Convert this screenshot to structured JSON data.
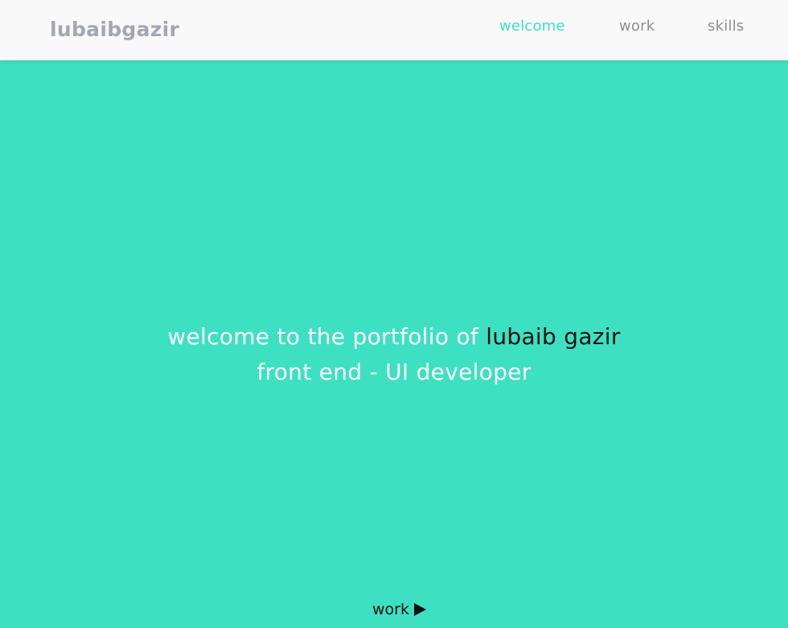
{
  "header": {
    "logo": "lubaibgazir",
    "nav": [
      {
        "label": "welcome",
        "active": true
      },
      {
        "label": "work",
        "active": false
      },
      {
        "label": "skills",
        "active": false
      }
    ]
  },
  "hero": {
    "line1_prefix": "welcome to the portfolio of",
    "line1_name": "lubaib gazir",
    "line2": "front end - UI developer"
  },
  "footer_link": {
    "label": "work",
    "icon": "play-icon"
  },
  "colors": {
    "accent": "#3ee0c2",
    "header_bg": "#f9f9f9",
    "logo": "#a3a7b2",
    "nav_text": "#8d8f98",
    "hero_text": "#ffffff",
    "name_text": "#111111"
  }
}
